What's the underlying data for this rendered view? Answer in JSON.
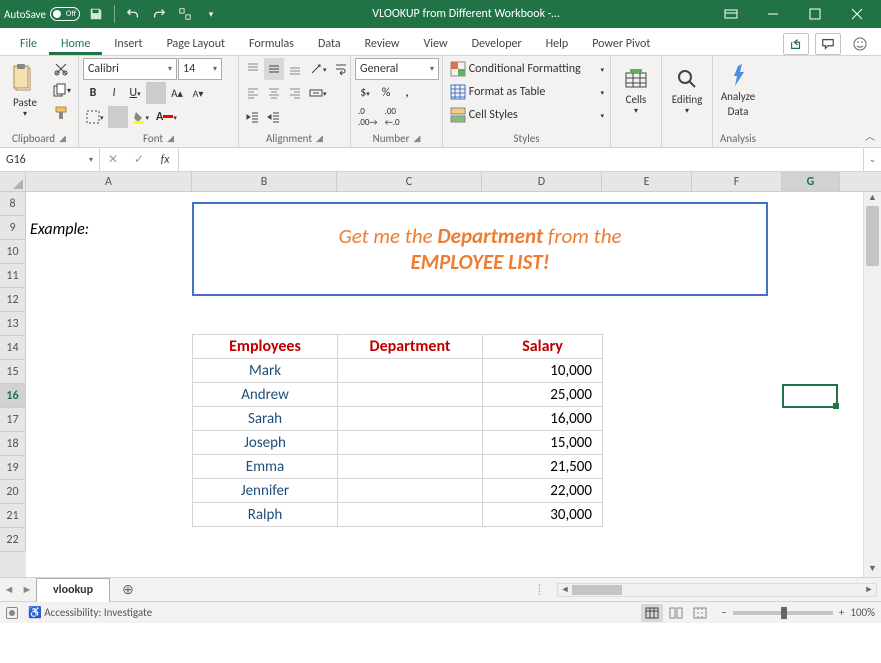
{
  "titlebar": {
    "autosave_label": "AutoSave",
    "autosave_off": "Off",
    "title": "VLOOKUP from Different Workbook  -…"
  },
  "menu": {
    "file": "File",
    "home": "Home",
    "insert": "Insert",
    "page_layout": "Page Layout",
    "formulas": "Formulas",
    "data": "Data",
    "review": "Review",
    "view": "View",
    "developer": "Developer",
    "help": "Help",
    "power_pivot": "Power Pivot"
  },
  "ribbon": {
    "clipboard": {
      "paste": "Paste",
      "label": "Clipboard"
    },
    "font": {
      "name": "Calibri",
      "size": "14",
      "label": "Font"
    },
    "alignment": {
      "label": "Alignment"
    },
    "number": {
      "format": "General",
      "label": "Number"
    },
    "styles": {
      "cond": "Conditional Formatting",
      "table": "Format as Table",
      "cell": "Cell Styles",
      "label": "Styles"
    },
    "cells": {
      "label": "Cells",
      "btn": "Cells"
    },
    "editing": {
      "label": "Editing",
      "btn": "Editing"
    },
    "analysis": {
      "btn1": "Analyze",
      "btn2": "Data",
      "label": "Analysis"
    }
  },
  "namebox": "G16",
  "columns": [
    "A",
    "B",
    "C",
    "D",
    "E",
    "F",
    "G"
  ],
  "rows": [
    "8",
    "9",
    "10",
    "11",
    "12",
    "13",
    "14",
    "15",
    "16",
    "17",
    "18",
    "19",
    "20",
    "21",
    "22"
  ],
  "example_label": "Example:",
  "textbox": {
    "line1_pre": "Get me the ",
    "line1_bold": "Department",
    "line1_post": " from the",
    "line2": "EMPLOYEE LIST!"
  },
  "table": {
    "headers": {
      "emp": "Employees",
      "dept": "Department",
      "sal": "Salary"
    },
    "rows": [
      {
        "name": "Mark",
        "dept": "",
        "salary": "10,000"
      },
      {
        "name": "Andrew",
        "dept": "",
        "salary": "25,000"
      },
      {
        "name": "Sarah",
        "dept": "",
        "salary": "16,000"
      },
      {
        "name": "Joseph",
        "dept": "",
        "salary": "15,000"
      },
      {
        "name": "Emma",
        "dept": "",
        "salary": "21,500"
      },
      {
        "name": "Jennifer",
        "dept": "",
        "salary": "22,000"
      },
      {
        "name": "Ralph",
        "dept": "",
        "salary": "30,000"
      }
    ]
  },
  "sheet": {
    "name": "vlookup"
  },
  "status": {
    "acc": "Accessibility: Investigate",
    "zoom": "100%"
  }
}
